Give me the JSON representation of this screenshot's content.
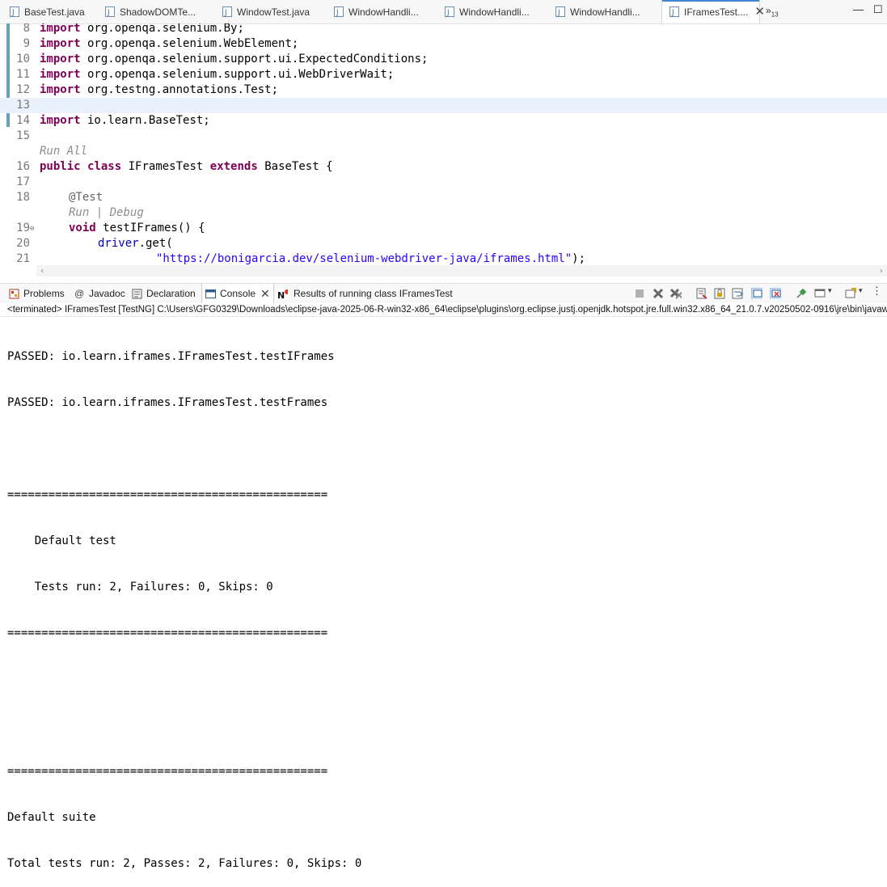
{
  "editor_tabs": [
    {
      "label": "BaseTest.java",
      "active": false
    },
    {
      "label": "ShadowDOMTe...",
      "active": false
    },
    {
      "label": "WindowTest.java",
      "active": false
    },
    {
      "label": "WindowHandli...",
      "active": false
    },
    {
      "label": "WindowHandli...",
      "active": false
    },
    {
      "label": "WindowHandli...",
      "active": false
    },
    {
      "label": "IFramesTest....",
      "active": true
    }
  ],
  "overflow": {
    "glyph": "»",
    "count": "13"
  },
  "window_controls": {
    "minimize": "—",
    "maximize": "☐"
  },
  "code_lines": [
    {
      "num": "8",
      "kw": "import",
      "rest": " org.openqa.selenium.By;"
    },
    {
      "num": "9",
      "kw": "import",
      "rest": " org.openqa.selenium.WebElement;"
    },
    {
      "num": "10",
      "kw": "import",
      "rest": " org.openqa.selenium.support.ui.ExpectedConditions;"
    },
    {
      "num": "11",
      "kw": "import",
      "rest": " org.openqa.selenium.support.ui.WebDriverWait;"
    },
    {
      "num": "12",
      "kw": "import",
      "rest": " org.testng.annotations.Test;"
    },
    {
      "num": "13"
    },
    {
      "num": "14",
      "kw": "import",
      "rest": " io.learn.BaseTest;"
    },
    {
      "num": "15"
    },
    {
      "lens": "Run All"
    },
    {
      "num": "16",
      "class_decl": {
        "kw1": "public",
        "kw2": "class",
        "name": "IFramesTest",
        "kw3": "extends",
        "parent": "BaseTest {"
      }
    },
    {
      "num": "17"
    },
    {
      "num": "18",
      "annotation": "@Test"
    },
    {
      "lens_run": "Run",
      "lens_sep": "|",
      "lens_debug": "Debug"
    },
    {
      "num": "19",
      "fold": "⊖",
      "method": {
        "kw": "void",
        "rest": " testIFrames() {"
      }
    },
    {
      "num": "20",
      "call": {
        "field": "driver",
        "rest": ".get("
      }
    },
    {
      "num": "21",
      "string": "\"https://bonigarcia.dev/selenium-webdriver-java/iframes.html\"",
      "tail": ");"
    }
  ],
  "view_tabs": [
    {
      "label": "Problems",
      "icon": "problems-icon"
    },
    {
      "label": "Javadoc",
      "icon": "javadoc-icon"
    },
    {
      "label": "Declaration",
      "icon": "declaration-icon"
    },
    {
      "label": "Console",
      "icon": "console-icon",
      "active": true
    },
    {
      "label": "Results of running class IFramesTest",
      "icon": "testng-icon"
    }
  ],
  "console_header": "<terminated> IFramesTest [TestNG] C:\\Users\\GFG0329\\Downloads\\eclipse-java-2025-06-R-win32-x86_64\\eclipse\\plugins\\org.eclipse.justj.openjdk.hotspot.jre.full.win32.x86_64_21.0.7.v20250502-0916\\jre\\bin\\javaw.exe",
  "console_lines": [
    "PASSED: io.learn.iframes.IFramesTest.testIFrames",
    "PASSED: io.learn.iframes.IFramesTest.testFrames",
    "",
    "===============================================",
    "    Default test",
    "    Tests run: 2, Failures: 0, Skips: 0",
    "===============================================",
    "",
    "",
    "===============================================",
    "Default suite",
    "Total tests run: 2, Passes: 2, Failures: 0, Skips: 0"
  ],
  "colors": {
    "keyword": "#7f0055",
    "string": "#2a00ff",
    "active_tab_accent": "#3c86d4",
    "current_line": "#e9f1fc"
  }
}
